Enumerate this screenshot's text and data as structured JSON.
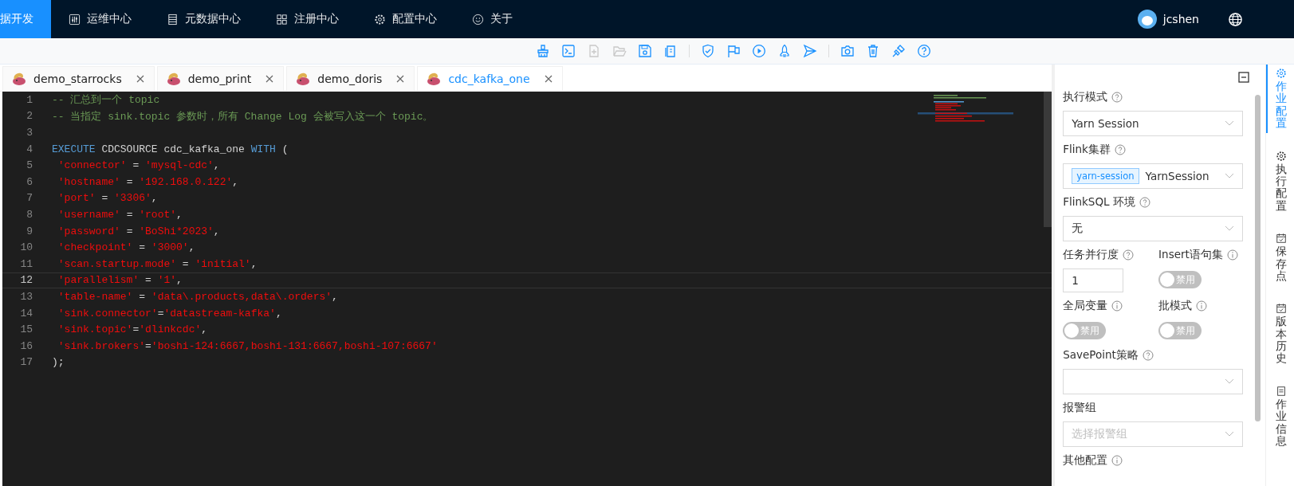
{
  "nav": {
    "items": [
      {
        "label": "据开发",
        "kind": "plain",
        "selected": true
      },
      {
        "label": "运维中心",
        "kind": "sliders",
        "selected": false
      },
      {
        "label": "元数据中心",
        "kind": "list",
        "selected": false
      },
      {
        "label": "注册中心",
        "kind": "grid",
        "selected": false
      },
      {
        "label": "配置中心",
        "kind": "gear",
        "selected": false
      },
      {
        "label": "关于",
        "kind": "smile",
        "selected": false
      }
    ],
    "user": "jcshen"
  },
  "toolbar": [
    {
      "kind": "broom",
      "disabled": false
    },
    {
      "kind": "terminal",
      "disabled": false
    },
    {
      "kind": "file-plus",
      "disabled": true
    },
    {
      "kind": "folder",
      "disabled": true
    },
    {
      "kind": "save",
      "disabled": false
    },
    {
      "kind": "copy",
      "disabled": false
    },
    {
      "kind": "sep"
    },
    {
      "kind": "shield",
      "disabled": false
    },
    {
      "kind": "flag",
      "disabled": false
    },
    {
      "kind": "play",
      "disabled": false
    },
    {
      "kind": "rocket",
      "disabled": false
    },
    {
      "kind": "send",
      "disabled": false
    },
    {
      "kind": "sep"
    },
    {
      "kind": "camera",
      "disabled": false
    },
    {
      "kind": "trash",
      "disabled": false
    },
    {
      "kind": "plug",
      "disabled": false
    },
    {
      "kind": "help",
      "disabled": false
    }
  ],
  "tabs": [
    {
      "label": "demo_starrocks",
      "selected": false
    },
    {
      "label": "demo_print",
      "selected": false
    },
    {
      "label": "demo_doris",
      "selected": false
    },
    {
      "label": "cdc_kafka_one",
      "selected": true
    }
  ],
  "editor": {
    "lines": [
      {
        "number": "1",
        "tokens": [
          {
            "kind": "comment",
            "text": "-- 汇总到一个 topic"
          }
        ]
      },
      {
        "number": "2",
        "tokens": [
          {
            "kind": "comment",
            "text": "-- 当指定 sink.topic 参数时，所有 Change Log 会被写入这一个 topic。"
          }
        ]
      },
      {
        "number": "3"
      },
      {
        "number": "4",
        "tokens": [
          {
            "kind": "keyword",
            "text": "EXECUTE"
          },
          {
            "kind": "plain",
            "text": " CDCSOURCE cdc_kafka_one "
          },
          {
            "kind": "keyword",
            "text": "WITH"
          },
          {
            "kind": "plain",
            "text": " ("
          }
        ]
      },
      {
        "number": "5",
        "tokens": [
          {
            "kind": "string",
            "text": " 'connector'"
          },
          {
            "kind": "plain",
            "text": " = "
          },
          {
            "kind": "string",
            "text": "'mysql-cdc'"
          },
          {
            "kind": "plain",
            "text": ","
          }
        ]
      },
      {
        "number": "6",
        "tokens": [
          {
            "kind": "string",
            "text": " 'hostname'"
          },
          {
            "kind": "plain",
            "text": " = "
          },
          {
            "kind": "string",
            "text": "'192.168.0.122'"
          },
          {
            "kind": "plain",
            "text": ","
          }
        ]
      },
      {
        "number": "7",
        "tokens": [
          {
            "kind": "string",
            "text": " 'port'"
          },
          {
            "kind": "plain",
            "text": " = "
          },
          {
            "kind": "string",
            "text": "'3306'"
          },
          {
            "kind": "plain",
            "text": ","
          }
        ]
      },
      {
        "number": "8",
        "tokens": [
          {
            "kind": "string",
            "text": " 'username'"
          },
          {
            "kind": "plain",
            "text": " = "
          },
          {
            "kind": "string",
            "text": "'root'"
          },
          {
            "kind": "plain",
            "text": ","
          }
        ]
      },
      {
        "number": "9",
        "tokens": [
          {
            "kind": "string",
            "text": " 'password'"
          },
          {
            "kind": "plain",
            "text": " = "
          },
          {
            "kind": "string",
            "text": "'BoShi*2023'"
          },
          {
            "kind": "plain",
            "text": ","
          }
        ]
      },
      {
        "number": "10",
        "tokens": [
          {
            "kind": "string",
            "text": " 'checkpoint'"
          },
          {
            "kind": "plain",
            "text": " = "
          },
          {
            "kind": "string",
            "text": "'3000'"
          },
          {
            "kind": "plain",
            "text": ","
          }
        ]
      },
      {
        "number": "11",
        "tokens": [
          {
            "kind": "string",
            "text": " 'scan.startup.mode'"
          },
          {
            "kind": "plain",
            "text": " = "
          },
          {
            "kind": "string",
            "text": "'initial'"
          },
          {
            "kind": "plain",
            "text": ","
          }
        ]
      },
      {
        "number": "12",
        "current": true,
        "tokens": [
          {
            "kind": "string",
            "text": " 'parallelism'"
          },
          {
            "kind": "plain",
            "text": " = "
          },
          {
            "kind": "string",
            "text": "'1'"
          },
          {
            "kind": "plain",
            "text": ","
          }
        ]
      },
      {
        "number": "13",
        "tokens": [
          {
            "kind": "string",
            "text": " 'table-name'"
          },
          {
            "kind": "plain",
            "text": " = "
          },
          {
            "kind": "string",
            "text": "'data\\.products,data\\.orders'"
          },
          {
            "kind": "plain",
            "text": ","
          }
        ]
      },
      {
        "number": "14",
        "tokens": [
          {
            "kind": "string",
            "text": " 'sink.connector'"
          },
          {
            "kind": "plain",
            "text": "="
          },
          {
            "kind": "string",
            "text": "'datastream-kafka'"
          },
          {
            "kind": "plain",
            "text": ","
          }
        ]
      },
      {
        "number": "15",
        "tokens": [
          {
            "kind": "string",
            "text": " 'sink.topic'"
          },
          {
            "kind": "plain",
            "text": "="
          },
          {
            "kind": "string",
            "text": "'dlinkcdc'"
          },
          {
            "kind": "plain",
            "text": ","
          }
        ]
      },
      {
        "number": "16",
        "tokens": [
          {
            "kind": "string",
            "text": " 'sink.brokers'"
          },
          {
            "kind": "plain",
            "text": "="
          },
          {
            "kind": "string",
            "text": "'boshi-124:6667,boshi-131:6667,boshi-107:6667'"
          }
        ]
      },
      {
        "number": "17",
        "tokens": [
          {
            "kind": "plain",
            "text": ");"
          }
        ]
      }
    ]
  },
  "panel": {
    "rows": [
      [
        {
          "kind": "select",
          "label": "执行模式",
          "hint": true,
          "value": "Yarn Session"
        }
      ],
      [
        {
          "kind": "select",
          "label": "Flink集群",
          "hint": true,
          "tag": "yarn-session",
          "value": "YarnSession"
        }
      ],
      [
        {
          "kind": "select",
          "label": "FlinkSQL 环境",
          "hint": true,
          "value": "无"
        }
      ],
      [
        {
          "kind": "number",
          "label": "任务并行度",
          "hint": true,
          "value": "1"
        },
        {
          "kind": "switch",
          "label": "Insert语句集",
          "hint": true,
          "on": false,
          "text": "禁用"
        }
      ],
      [
        {
          "kind": "switch",
          "label": "全局变量",
          "hint": true,
          "on": false,
          "text": "禁用"
        },
        {
          "kind": "switch",
          "label": "批模式",
          "hint": true,
          "on": false,
          "text": "禁用"
        }
      ],
      [
        {
          "kind": "select",
          "label": "SavePoint策略",
          "hint": true
        }
      ],
      [
        {
          "kind": "select",
          "label": "报警组",
          "hint": false,
          "placeholder": "选择报警组"
        }
      ],
      [
        {
          "kind": "heading",
          "label": "其他配置",
          "hint": true
        }
      ]
    ]
  },
  "side_tabs": [
    {
      "label": "作业配置",
      "kind": "gear",
      "selected": true
    },
    {
      "label": "执行配置",
      "kind": "gear",
      "selected": false
    },
    {
      "label": "保存点",
      "kind": "calendar",
      "selected": false
    },
    {
      "label": "版本历史",
      "kind": "calendar",
      "selected": false
    },
    {
      "label": "作业信息",
      "kind": "doc",
      "selected": false
    }
  ]
}
